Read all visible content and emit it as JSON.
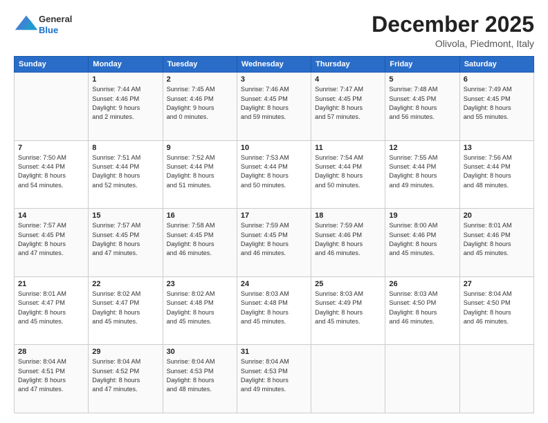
{
  "header": {
    "logo_general": "General",
    "logo_blue": "Blue",
    "month_title": "December 2025",
    "location": "Olivola, Piedmont, Italy"
  },
  "calendar": {
    "days_of_week": [
      "Sunday",
      "Monday",
      "Tuesday",
      "Wednesday",
      "Thursday",
      "Friday",
      "Saturday"
    ],
    "weeks": [
      [
        {
          "day": "",
          "sunrise": "",
          "sunset": "",
          "daylight": ""
        },
        {
          "day": "1",
          "sunrise": "Sunrise: 7:44 AM",
          "sunset": "Sunset: 4:46 PM",
          "daylight": "Daylight: 9 hours and 2 minutes."
        },
        {
          "day": "2",
          "sunrise": "Sunrise: 7:45 AM",
          "sunset": "Sunset: 4:46 PM",
          "daylight": "Daylight: 9 hours and 0 minutes."
        },
        {
          "day": "3",
          "sunrise": "Sunrise: 7:46 AM",
          "sunset": "Sunset: 4:45 PM",
          "daylight": "Daylight: 8 hours and 59 minutes."
        },
        {
          "day": "4",
          "sunrise": "Sunrise: 7:47 AM",
          "sunset": "Sunset: 4:45 PM",
          "daylight": "Daylight: 8 hours and 57 minutes."
        },
        {
          "day": "5",
          "sunrise": "Sunrise: 7:48 AM",
          "sunset": "Sunset: 4:45 PM",
          "daylight": "Daylight: 8 hours and 56 minutes."
        },
        {
          "day": "6",
          "sunrise": "Sunrise: 7:49 AM",
          "sunset": "Sunset: 4:45 PM",
          "daylight": "Daylight: 8 hours and 55 minutes."
        }
      ],
      [
        {
          "day": "7",
          "sunrise": "Sunrise: 7:50 AM",
          "sunset": "Sunset: 4:44 PM",
          "daylight": "Daylight: 8 hours and 54 minutes."
        },
        {
          "day": "8",
          "sunrise": "Sunrise: 7:51 AM",
          "sunset": "Sunset: 4:44 PM",
          "daylight": "Daylight: 8 hours and 52 minutes."
        },
        {
          "day": "9",
          "sunrise": "Sunrise: 7:52 AM",
          "sunset": "Sunset: 4:44 PM",
          "daylight": "Daylight: 8 hours and 51 minutes."
        },
        {
          "day": "10",
          "sunrise": "Sunrise: 7:53 AM",
          "sunset": "Sunset: 4:44 PM",
          "daylight": "Daylight: 8 hours and 50 minutes."
        },
        {
          "day": "11",
          "sunrise": "Sunrise: 7:54 AM",
          "sunset": "Sunset: 4:44 PM",
          "daylight": "Daylight: 8 hours and 50 minutes."
        },
        {
          "day": "12",
          "sunrise": "Sunrise: 7:55 AM",
          "sunset": "Sunset: 4:44 PM",
          "daylight": "Daylight: 8 hours and 49 minutes."
        },
        {
          "day": "13",
          "sunrise": "Sunrise: 7:56 AM",
          "sunset": "Sunset: 4:44 PM",
          "daylight": "Daylight: 8 hours and 48 minutes."
        }
      ],
      [
        {
          "day": "14",
          "sunrise": "Sunrise: 7:57 AM",
          "sunset": "Sunset: 4:45 PM",
          "daylight": "Daylight: 8 hours and 47 minutes."
        },
        {
          "day": "15",
          "sunrise": "Sunrise: 7:57 AM",
          "sunset": "Sunset: 4:45 PM",
          "daylight": "Daylight: 8 hours and 47 minutes."
        },
        {
          "day": "16",
          "sunrise": "Sunrise: 7:58 AM",
          "sunset": "Sunset: 4:45 PM",
          "daylight": "Daylight: 8 hours and 46 minutes."
        },
        {
          "day": "17",
          "sunrise": "Sunrise: 7:59 AM",
          "sunset": "Sunset: 4:45 PM",
          "daylight": "Daylight: 8 hours and 46 minutes."
        },
        {
          "day": "18",
          "sunrise": "Sunrise: 7:59 AM",
          "sunset": "Sunset: 4:46 PM",
          "daylight": "Daylight: 8 hours and 46 minutes."
        },
        {
          "day": "19",
          "sunrise": "Sunrise: 8:00 AM",
          "sunset": "Sunset: 4:46 PM",
          "daylight": "Daylight: 8 hours and 45 minutes."
        },
        {
          "day": "20",
          "sunrise": "Sunrise: 8:01 AM",
          "sunset": "Sunset: 4:46 PM",
          "daylight": "Daylight: 8 hours and 45 minutes."
        }
      ],
      [
        {
          "day": "21",
          "sunrise": "Sunrise: 8:01 AM",
          "sunset": "Sunset: 4:47 PM",
          "daylight": "Daylight: 8 hours and 45 minutes."
        },
        {
          "day": "22",
          "sunrise": "Sunrise: 8:02 AM",
          "sunset": "Sunset: 4:47 PM",
          "daylight": "Daylight: 8 hours and 45 minutes."
        },
        {
          "day": "23",
          "sunrise": "Sunrise: 8:02 AM",
          "sunset": "Sunset: 4:48 PM",
          "daylight": "Daylight: 8 hours and 45 minutes."
        },
        {
          "day": "24",
          "sunrise": "Sunrise: 8:03 AM",
          "sunset": "Sunset: 4:48 PM",
          "daylight": "Daylight: 8 hours and 45 minutes."
        },
        {
          "day": "25",
          "sunrise": "Sunrise: 8:03 AM",
          "sunset": "Sunset: 4:49 PM",
          "daylight": "Daylight: 8 hours and 45 minutes."
        },
        {
          "day": "26",
          "sunrise": "Sunrise: 8:03 AM",
          "sunset": "Sunset: 4:50 PM",
          "daylight": "Daylight: 8 hours and 46 minutes."
        },
        {
          "day": "27",
          "sunrise": "Sunrise: 8:04 AM",
          "sunset": "Sunset: 4:50 PM",
          "daylight": "Daylight: 8 hours and 46 minutes."
        }
      ],
      [
        {
          "day": "28",
          "sunrise": "Sunrise: 8:04 AM",
          "sunset": "Sunset: 4:51 PM",
          "daylight": "Daylight: 8 hours and 47 minutes."
        },
        {
          "day": "29",
          "sunrise": "Sunrise: 8:04 AM",
          "sunset": "Sunset: 4:52 PM",
          "daylight": "Daylight: 8 hours and 47 minutes."
        },
        {
          "day": "30",
          "sunrise": "Sunrise: 8:04 AM",
          "sunset": "Sunset: 4:53 PM",
          "daylight": "Daylight: 8 hours and 48 minutes."
        },
        {
          "day": "31",
          "sunrise": "Sunrise: 8:04 AM",
          "sunset": "Sunset: 4:53 PM",
          "daylight": "Daylight: 8 hours and 49 minutes."
        },
        {
          "day": "",
          "sunrise": "",
          "sunset": "",
          "daylight": ""
        },
        {
          "day": "",
          "sunrise": "",
          "sunset": "",
          "daylight": ""
        },
        {
          "day": "",
          "sunrise": "",
          "sunset": "",
          "daylight": ""
        }
      ]
    ]
  }
}
